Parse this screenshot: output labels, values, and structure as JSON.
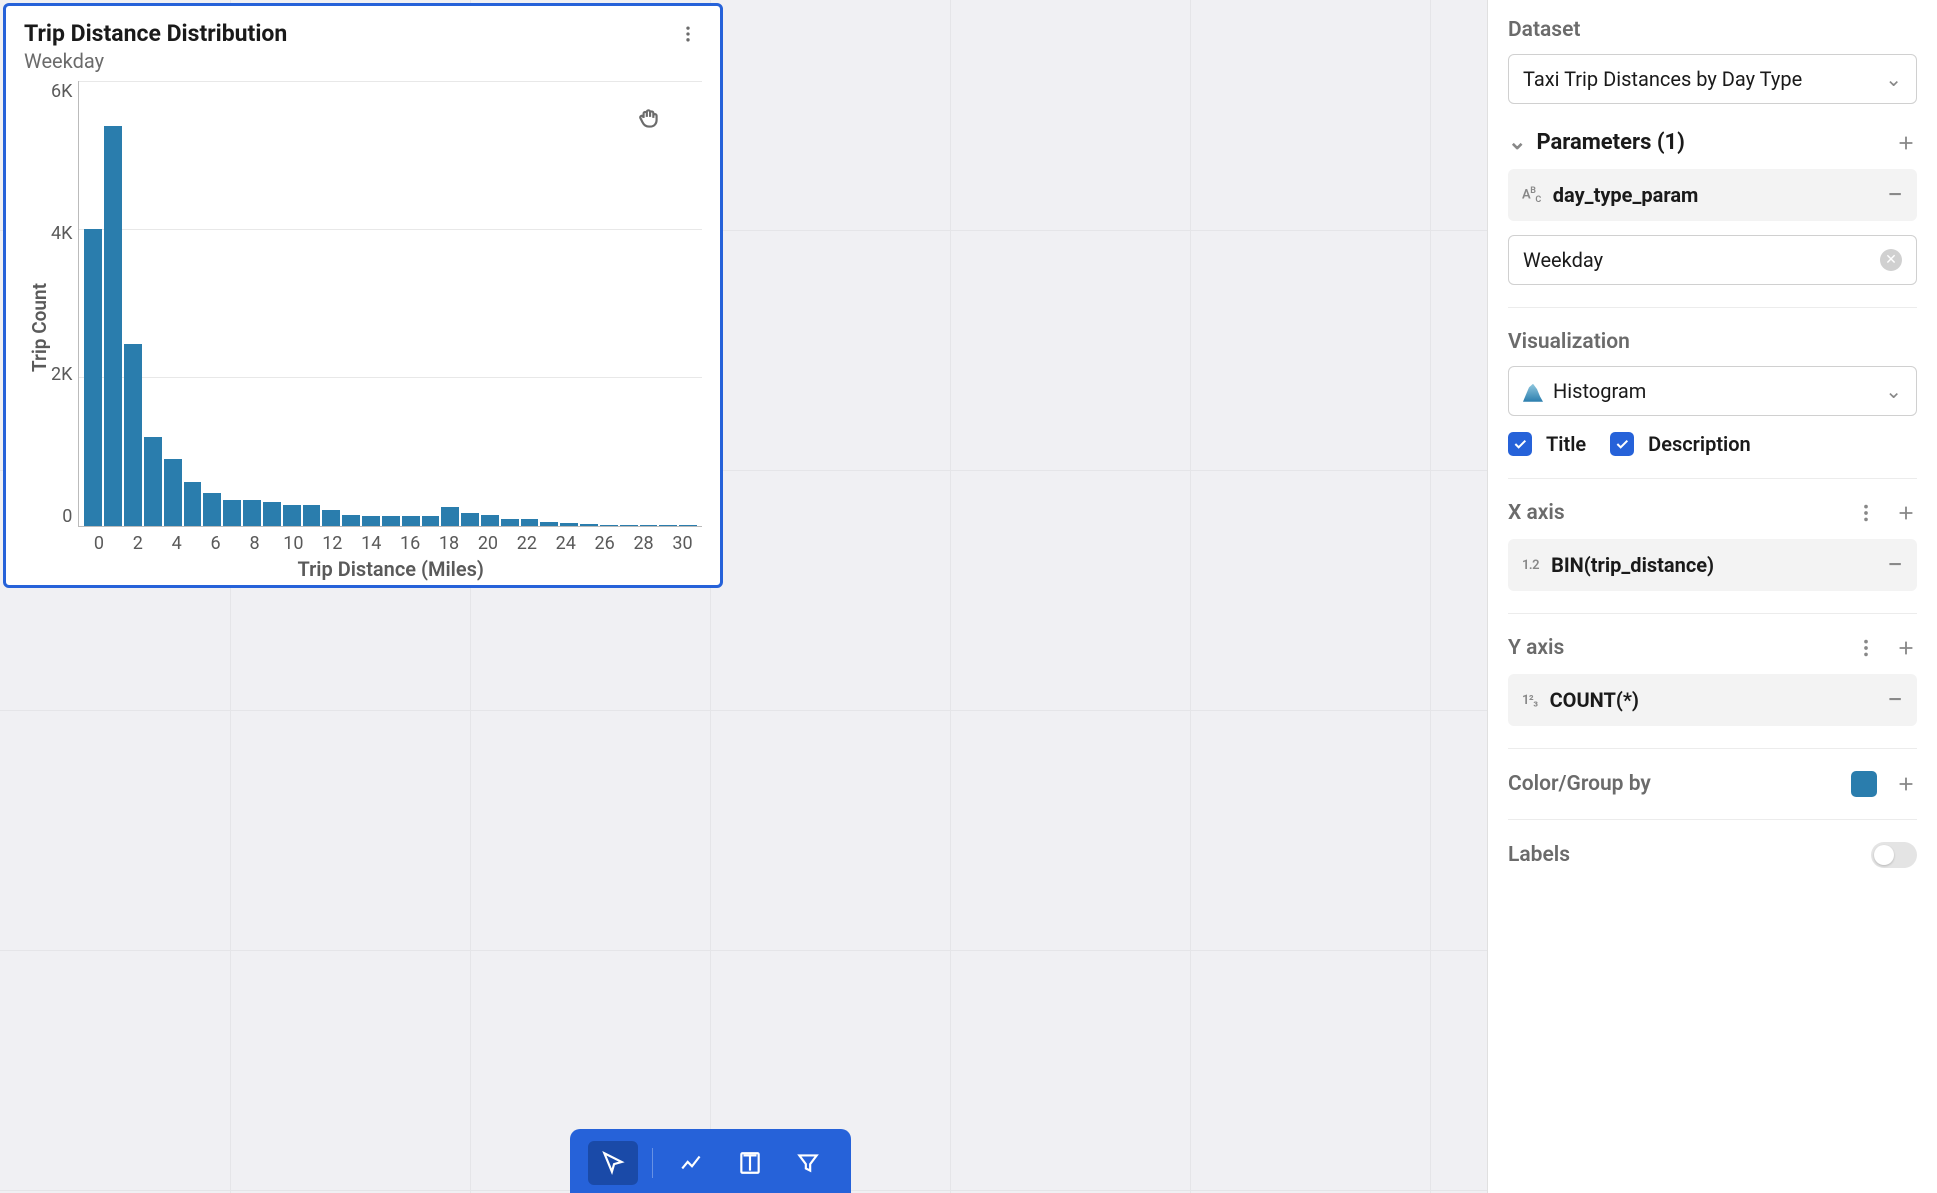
{
  "chart": {
    "title": "Trip Distance Distribution",
    "subtitle": "Weekday"
  },
  "chart_data": {
    "type": "bar",
    "title": "Trip Distance Distribution",
    "xlabel": "Trip Distance (Miles)",
    "ylabel": "Trip Count",
    "categories": [
      0,
      1,
      2,
      3,
      4,
      5,
      6,
      7,
      8,
      9,
      10,
      11,
      12,
      13,
      14,
      15,
      16,
      17,
      18,
      19,
      20,
      21,
      22,
      23,
      24,
      25,
      26,
      27,
      28,
      29,
      30
    ],
    "values": [
      4000,
      5400,
      2450,
      1200,
      900,
      600,
      450,
      350,
      350,
      330,
      280,
      280,
      220,
      150,
      140,
      130,
      130,
      140,
      250,
      180,
      150,
      100,
      90,
      50,
      40,
      30,
      20,
      20,
      15,
      10,
      10
    ],
    "ylim": [
      0,
      6000
    ],
    "y_ticks": [
      "6K",
      "4K",
      "2K",
      "0"
    ],
    "x_ticks": [
      "0",
      "2",
      "4",
      "6",
      "8",
      "10",
      "12",
      "14",
      "16",
      "18",
      "20",
      "22",
      "24",
      "26",
      "28",
      "30"
    ]
  },
  "panel": {
    "dataset_label": "Dataset",
    "dataset_value": "Taxi Trip Distances by Day Type",
    "parameters_label": "Parameters (1)",
    "param_name": "day_type_param",
    "param_value": "Weekday",
    "visualization_label": "Visualization",
    "viz_type": "Histogram",
    "title_check": "Title",
    "description_check": "Description",
    "xaxis_label": "X axis",
    "xaxis_field": "BIN(trip_distance)",
    "xaxis_icon": "1.2",
    "yaxis_label": "Y axis",
    "yaxis_field": "COUNT(*)",
    "yaxis_icon": "1²₃",
    "color_group_label": "Color/Group by",
    "labels_label": "Labels"
  }
}
